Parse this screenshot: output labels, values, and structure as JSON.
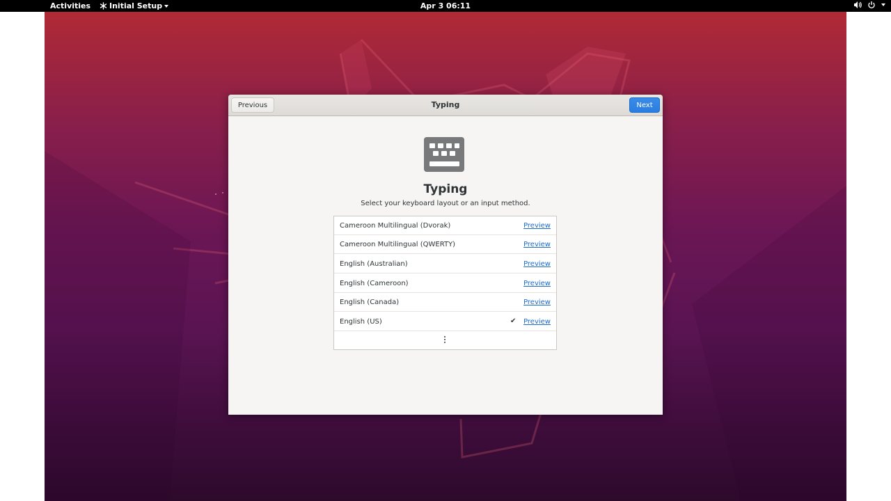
{
  "topbar": {
    "activities": "Activities",
    "app_menu": "Initial Setup",
    "clock": "Apr 3  06:11",
    "icons": [
      "volume-icon",
      "power-icon",
      "system-menu-caret-icon"
    ]
  },
  "window": {
    "title": "Typing",
    "previous_label": "Previous",
    "next_label": "Next",
    "heading": "Typing",
    "subtitle": "Select your keyboard layout or an input method.",
    "layouts": [
      {
        "name": "Cameroon Multilingual (Dvorak)",
        "preview": "Preview",
        "selected": false
      },
      {
        "name": "Cameroon Multilingual (QWERTY)",
        "preview": "Preview",
        "selected": false
      },
      {
        "name": "English (Australian)",
        "preview": "Preview",
        "selected": false
      },
      {
        "name": "English (Cameroon)",
        "preview": "Preview",
        "selected": false
      },
      {
        "name": "English (Canada)",
        "preview": "Preview",
        "selected": false
      },
      {
        "name": "English (US)",
        "preview": "Preview",
        "selected": true
      }
    ],
    "check_glyph": "✔"
  },
  "colors": {
    "accent": "#2a7ee0",
    "link": "#1b6acb",
    "desktop_top": "#b02a35",
    "desktop_bottom": "#2d0a2c"
  }
}
